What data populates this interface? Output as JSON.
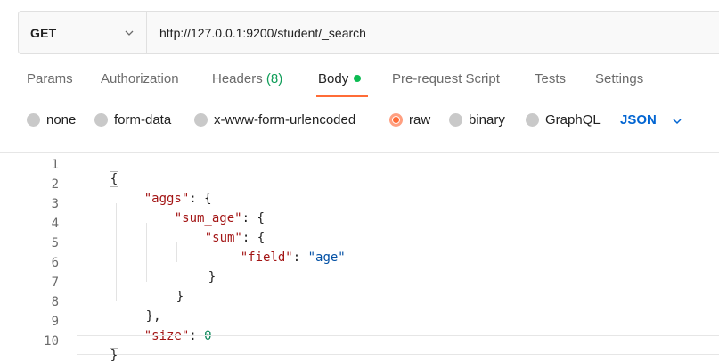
{
  "request": {
    "method": "GET",
    "url": "http://127.0.0.1:9200/student/_search"
  },
  "tabs": [
    {
      "label": "Params"
    },
    {
      "label": "Authorization"
    },
    {
      "label": "Headers",
      "count": "(8)"
    },
    {
      "label": "Body"
    },
    {
      "label": "Pre-request Script"
    },
    {
      "label": "Tests"
    },
    {
      "label": "Settings"
    }
  ],
  "active_tab": "Body",
  "body_modes": [
    {
      "label": "none"
    },
    {
      "label": "form-data"
    },
    {
      "label": "x-www-form-urlencoded"
    },
    {
      "label": "raw"
    },
    {
      "label": "binary"
    },
    {
      "label": "GraphQL"
    }
  ],
  "selected_mode": "raw",
  "raw_type": "JSON",
  "editor": {
    "line_numbers": [
      "1",
      "2",
      "3",
      "4",
      "5",
      "6",
      "7",
      "8",
      "9",
      "10"
    ],
    "lines": [
      {
        "text": "{"
      },
      {
        "key": "\"aggs\"",
        "sep": ": ",
        "rest": "{"
      },
      {
        "key": "\"sum_age\"",
        "sep": ": ",
        "rest": "{"
      },
      {
        "key": "\"sum\"",
        "sep": ": ",
        "rest": "{"
      },
      {
        "key": "\"field\"",
        "sep": ": ",
        "str": "\"age\""
      },
      {
        "text": "}"
      },
      {
        "text": "}"
      },
      {
        "text": "},"
      },
      {
        "key": "\"size\"",
        "sep": ": ",
        "num": "0"
      },
      {
        "text": "}"
      }
    ]
  },
  "colors": {
    "accent": "#ff6c37",
    "json_link": "#0265d2",
    "success": "#0cbb52",
    "json_key": "#a31515",
    "json_number": "#098658",
    "json_string": "#0451a5"
  }
}
